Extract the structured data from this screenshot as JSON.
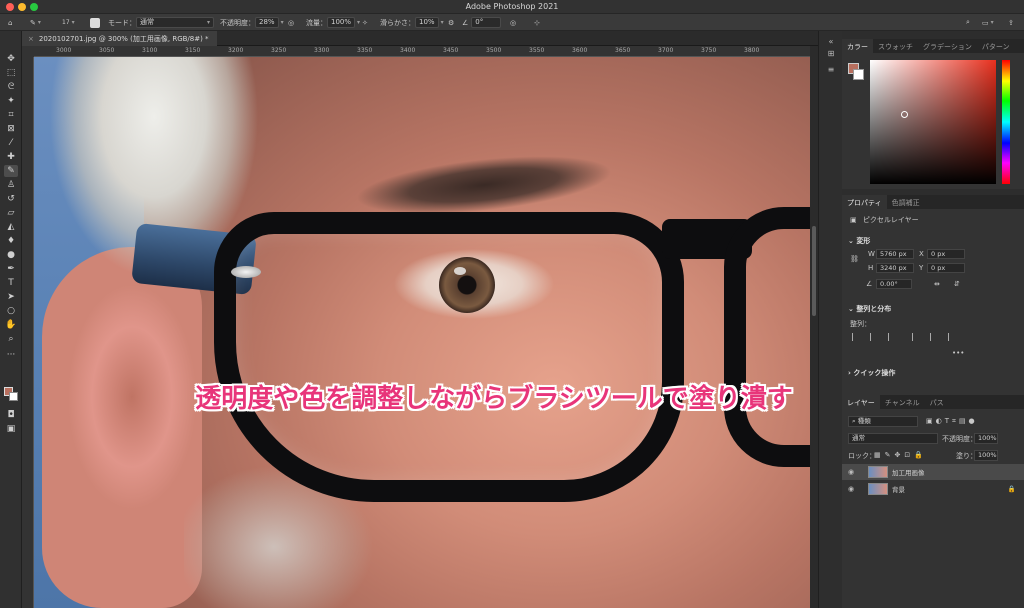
{
  "app": {
    "title": "Adobe Photoshop 2021"
  },
  "options_bar": {
    "brush_size": "17",
    "mode_label": "モード：",
    "mode_value": "通常",
    "opacity_label": "不透明度：",
    "opacity_value": "28%",
    "flow_label": "流量：",
    "flow_value": "100%",
    "smoothing_label": "滑らかさ：",
    "smoothing_value": "10%",
    "angle_value": "0°"
  },
  "document": {
    "tab_title": "2020102701.jpg @ 300% (加工用画像, RGB/8#) *"
  },
  "ruler": {
    "ticks": [
      "3000",
      "3050",
      "3100",
      "3150",
      "3200",
      "3250",
      "3300",
      "3350",
      "3400",
      "3450",
      "3500",
      "3550",
      "3600",
      "3650",
      "3700",
      "3750",
      "3800"
    ]
  },
  "canvas": {
    "overlay_caption": "透明度や色を調整しながらブラシツールで塗り潰す"
  },
  "panels": {
    "color_tabs": [
      "カラー",
      "スウォッチ",
      "グラデーション",
      "パターン"
    ],
    "properties_tabs": [
      "プロパティ",
      "色調補正"
    ],
    "pixel_layer_label": "ピクセルレイヤー",
    "transform_heading": "変形",
    "w_label": "W",
    "w_value": "5760 px",
    "h_label": "H",
    "h_value": "3240 px",
    "x_label": "X",
    "x_value": "0 px",
    "y_label": "Y",
    "y_value": "0 px",
    "angle_value": "0.00°",
    "align_heading": "整列と分布",
    "align_label": "整列：",
    "more": "•••",
    "quick_actions_heading": "クイック操作",
    "layers_tabs": [
      "レイヤー",
      "チャンネル",
      "パス"
    ],
    "kind_filter": "種類",
    "blend_mode": "通常",
    "layer_opacity_label": "不透明度：",
    "layer_opacity_value": "100%",
    "lock_label": "ロック：",
    "fill_label": "塗り：",
    "fill_value": "100%",
    "layers": [
      {
        "name": "加工用画像"
      },
      {
        "name": "背景"
      }
    ]
  },
  "colors": {
    "accent_caption": "#e8357a",
    "foreground_swatch": "#b86f5e",
    "background_swatch": "#ffffff"
  }
}
